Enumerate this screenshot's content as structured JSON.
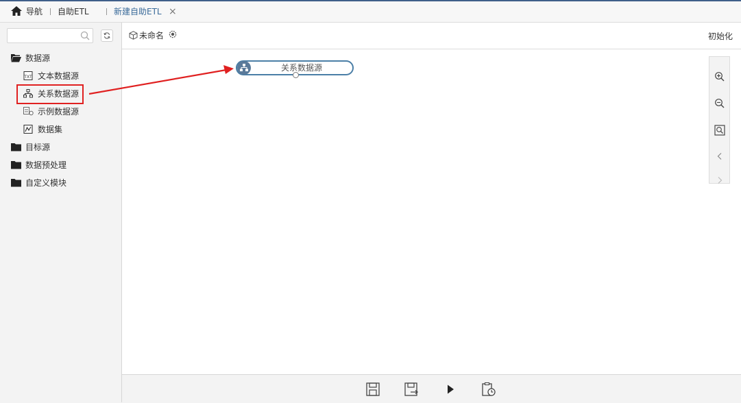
{
  "tabs": {
    "home_label": "导航",
    "etl_label": "自助ETL",
    "new_label": "新建自助ETL",
    "close_glyph": "×"
  },
  "sidebar": {
    "search_placeholder": "",
    "items": [
      {
        "label": "数据源",
        "icon": "folder-open-icon"
      },
      {
        "label": "文本数据源",
        "icon": "text-file-icon"
      },
      {
        "label": "关系数据源",
        "icon": "relational-db-icon"
      },
      {
        "label": "示例数据源",
        "icon": "sample-db-icon"
      },
      {
        "label": "数据集",
        "icon": "dataset-icon"
      },
      {
        "label": "目标源",
        "icon": "folder-icon"
      },
      {
        "label": "数据预处理",
        "icon": "folder-icon"
      },
      {
        "label": "自定义模块",
        "icon": "folder-icon"
      }
    ]
  },
  "header": {
    "project_name": "未命名",
    "init_label": "初始化"
  },
  "canvas": {
    "node_label": "关系数据源"
  },
  "colors": {
    "accent": "#4a7ea6",
    "highlight": "#e02020"
  }
}
